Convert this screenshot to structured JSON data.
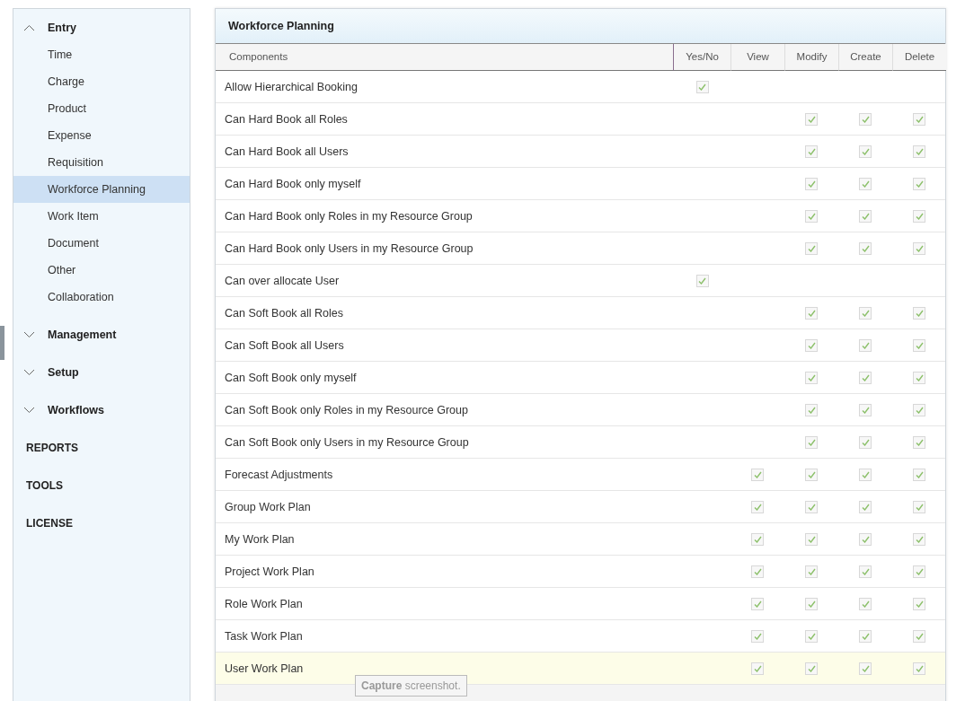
{
  "sidebar": {
    "groups": [
      {
        "label": "Entry",
        "expanded": true,
        "items": [
          {
            "label": "Time",
            "selected": false
          },
          {
            "label": "Charge",
            "selected": false
          },
          {
            "label": "Product",
            "selected": false
          },
          {
            "label": "Expense",
            "selected": false
          },
          {
            "label": "Requisition",
            "selected": false
          },
          {
            "label": "Workforce Planning",
            "selected": true
          },
          {
            "label": "Work Item",
            "selected": false
          },
          {
            "label": "Document",
            "selected": false
          },
          {
            "label": "Other",
            "selected": false
          },
          {
            "label": "Collaboration",
            "selected": false
          }
        ]
      },
      {
        "label": "Management",
        "expanded": false
      },
      {
        "label": "Setup",
        "expanded": false
      },
      {
        "label": "Workflows",
        "expanded": false
      }
    ],
    "sections": [
      "REPORTS",
      "TOOLS",
      "LICENSE"
    ]
  },
  "panel": {
    "title": "Workforce Planning",
    "columns": [
      "Components",
      "Yes/No",
      "View",
      "Modify",
      "Create",
      "Delete"
    ],
    "rows": [
      {
        "label": "Allow Hierarchical Booking",
        "highlighted": false,
        "cells": [
          {
            "kind": "checkbox",
            "checked": true
          },
          {
            "kind": "empty"
          },
          {
            "kind": "empty"
          },
          {
            "kind": "empty"
          },
          {
            "kind": "empty"
          }
        ]
      },
      {
        "label": "Can Hard Book all Roles",
        "highlighted": false,
        "cells": [
          {
            "kind": "empty"
          },
          {
            "kind": "empty"
          },
          {
            "kind": "checkbox",
            "checked": true
          },
          {
            "kind": "checkbox",
            "checked": true
          },
          {
            "kind": "checkbox",
            "checked": true
          }
        ]
      },
      {
        "label": "Can Hard Book all Users",
        "highlighted": false,
        "cells": [
          {
            "kind": "empty"
          },
          {
            "kind": "empty"
          },
          {
            "kind": "checkbox",
            "checked": true
          },
          {
            "kind": "checkbox",
            "checked": true
          },
          {
            "kind": "checkbox",
            "checked": true
          }
        ]
      },
      {
        "label": "Can Hard Book only myself",
        "highlighted": false,
        "cells": [
          {
            "kind": "empty"
          },
          {
            "kind": "empty"
          },
          {
            "kind": "checkbox",
            "checked": true
          },
          {
            "kind": "checkbox",
            "checked": true
          },
          {
            "kind": "checkbox",
            "checked": true
          }
        ]
      },
      {
        "label": "Can Hard Book only Roles in my Resource Group",
        "highlighted": false,
        "cells": [
          {
            "kind": "empty"
          },
          {
            "kind": "empty"
          },
          {
            "kind": "checkbox",
            "checked": true
          },
          {
            "kind": "checkbox",
            "checked": true
          },
          {
            "kind": "checkbox",
            "checked": true
          }
        ]
      },
      {
        "label": "Can Hard Book only Users in my Resource Group",
        "highlighted": false,
        "cells": [
          {
            "kind": "empty"
          },
          {
            "kind": "empty"
          },
          {
            "kind": "checkbox",
            "checked": true
          },
          {
            "kind": "checkbox",
            "checked": true
          },
          {
            "kind": "checkbox",
            "checked": true
          }
        ]
      },
      {
        "label": "Can over allocate User",
        "highlighted": false,
        "cells": [
          {
            "kind": "checkbox",
            "checked": true
          },
          {
            "kind": "empty"
          },
          {
            "kind": "empty"
          },
          {
            "kind": "empty"
          },
          {
            "kind": "empty"
          }
        ]
      },
      {
        "label": "Can Soft Book all Roles",
        "highlighted": false,
        "cells": [
          {
            "kind": "empty"
          },
          {
            "kind": "empty"
          },
          {
            "kind": "checkbox",
            "checked": true
          },
          {
            "kind": "checkbox",
            "checked": true
          },
          {
            "kind": "checkbox",
            "checked": true
          }
        ]
      },
      {
        "label": "Can Soft Book all Users",
        "highlighted": false,
        "cells": [
          {
            "kind": "empty"
          },
          {
            "kind": "empty"
          },
          {
            "kind": "checkbox",
            "checked": true
          },
          {
            "kind": "checkbox",
            "checked": true
          },
          {
            "kind": "checkbox",
            "checked": true
          }
        ]
      },
      {
        "label": "Can Soft Book only myself",
        "highlighted": false,
        "cells": [
          {
            "kind": "empty"
          },
          {
            "kind": "empty"
          },
          {
            "kind": "checkbox",
            "checked": true
          },
          {
            "kind": "checkbox",
            "checked": true
          },
          {
            "kind": "checkbox",
            "checked": true
          }
        ]
      },
      {
        "label": "Can Soft Book only Roles in my Resource Group",
        "highlighted": false,
        "cells": [
          {
            "kind": "empty"
          },
          {
            "kind": "empty"
          },
          {
            "kind": "checkbox",
            "checked": true
          },
          {
            "kind": "checkbox",
            "checked": true
          },
          {
            "kind": "checkbox",
            "checked": true
          }
        ]
      },
      {
        "label": "Can Soft Book only Users in my Resource Group",
        "highlighted": false,
        "cells": [
          {
            "kind": "empty"
          },
          {
            "kind": "empty"
          },
          {
            "kind": "checkbox",
            "checked": true
          },
          {
            "kind": "checkbox",
            "checked": true
          },
          {
            "kind": "checkbox",
            "checked": true
          }
        ]
      },
      {
        "label": "Forecast Adjustments",
        "highlighted": false,
        "cells": [
          {
            "kind": "empty"
          },
          {
            "kind": "checkbox",
            "checked": true
          },
          {
            "kind": "checkbox",
            "checked": true
          },
          {
            "kind": "checkbox",
            "checked": true
          },
          {
            "kind": "checkbox",
            "checked": true
          }
        ]
      },
      {
        "label": "Group Work Plan",
        "highlighted": false,
        "cells": [
          {
            "kind": "empty"
          },
          {
            "kind": "checkbox",
            "checked": true
          },
          {
            "kind": "checkbox",
            "checked": true
          },
          {
            "kind": "checkbox",
            "checked": true
          },
          {
            "kind": "checkbox",
            "checked": true
          }
        ]
      },
      {
        "label": "My Work Plan",
        "highlighted": false,
        "cells": [
          {
            "kind": "empty"
          },
          {
            "kind": "checkbox",
            "checked": true
          },
          {
            "kind": "checkbox",
            "checked": true
          },
          {
            "kind": "checkbox",
            "checked": true
          },
          {
            "kind": "checkbox",
            "checked": true
          }
        ]
      },
      {
        "label": "Project Work Plan",
        "highlighted": false,
        "cells": [
          {
            "kind": "empty"
          },
          {
            "kind": "checkbox",
            "checked": true
          },
          {
            "kind": "checkbox",
            "checked": true
          },
          {
            "kind": "checkbox",
            "checked": true
          },
          {
            "kind": "checkbox",
            "checked": true
          }
        ]
      },
      {
        "label": "Role Work Plan",
        "highlighted": false,
        "cells": [
          {
            "kind": "empty"
          },
          {
            "kind": "checkbox",
            "checked": true
          },
          {
            "kind": "checkbox",
            "checked": true
          },
          {
            "kind": "checkbox",
            "checked": true
          },
          {
            "kind": "checkbox",
            "checked": true
          }
        ]
      },
      {
        "label": "Task Work Plan",
        "highlighted": false,
        "cells": [
          {
            "kind": "empty"
          },
          {
            "kind": "checkbox",
            "checked": true
          },
          {
            "kind": "checkbox",
            "checked": true
          },
          {
            "kind": "checkbox",
            "checked": true
          },
          {
            "kind": "checkbox",
            "checked": true
          }
        ]
      },
      {
        "label": "User Work Plan",
        "highlighted": true,
        "cells": [
          {
            "kind": "empty"
          },
          {
            "kind": "checkbox",
            "checked": true
          },
          {
            "kind": "checkbox",
            "checked": true
          },
          {
            "kind": "checkbox",
            "checked": true
          },
          {
            "kind": "checkbox",
            "checked": true
          }
        ]
      }
    ]
  },
  "tooltip": "**Capture** screenshot."
}
